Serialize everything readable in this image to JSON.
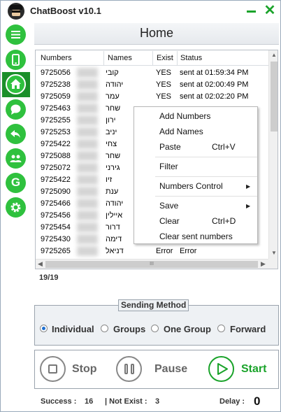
{
  "app": {
    "title": "ChatBoost v10.1"
  },
  "header": {
    "title": "Home"
  },
  "sidebar": {
    "items": [
      {
        "name": "menu"
      },
      {
        "name": "phone"
      },
      {
        "name": "home"
      },
      {
        "name": "chat"
      },
      {
        "name": "back"
      },
      {
        "name": "contacts"
      },
      {
        "name": "groups-g"
      },
      {
        "name": "settings"
      }
    ],
    "g_label": "G"
  },
  "grid": {
    "columns": [
      "Numbers",
      "Names",
      "Exist",
      "Status"
    ],
    "rows": [
      {
        "number": "9725056",
        "name": "קובי",
        "exist": "YES",
        "status": "sent at 01:59:34 PM"
      },
      {
        "number": "9725238",
        "name": "יהודה",
        "exist": "YES",
        "status": "sent at 02:00:49 PM"
      },
      {
        "number": "9725059",
        "name": "עמר",
        "exist": "YES",
        "status": "sent at 02:02:20 PM"
      },
      {
        "number": "9725463",
        "name": "שחר",
        "exist": "",
        "status": ""
      },
      {
        "number": "9725255",
        "name": "ירון",
        "exist": "",
        "status": ""
      },
      {
        "number": "9725253",
        "name": "יניב",
        "exist": "",
        "status": ""
      },
      {
        "number": "9725422",
        "name": "צחי",
        "exist": "",
        "status": ""
      },
      {
        "number": "9725088",
        "name": "שחר",
        "exist": "",
        "status": ""
      },
      {
        "number": "9725072",
        "name": "גירני",
        "exist": "",
        "status": ""
      },
      {
        "number": "9725422",
        "name": "זיו",
        "exist": "",
        "status": ""
      },
      {
        "number": "9725090",
        "name": "ענת",
        "exist": "",
        "status": ""
      },
      {
        "number": "9725466",
        "name": "יהודה",
        "exist": "",
        "status": ""
      },
      {
        "number": "9725456",
        "name": "איילין",
        "exist": "",
        "status": ""
      },
      {
        "number": "9725454",
        "name": "דרור",
        "exist": "",
        "status": ""
      },
      {
        "number": "9725430",
        "name": "דימה",
        "exist": "",
        "status": ""
      },
      {
        "number": "9725265",
        "name": "דניאל",
        "exist": "Error",
        "status": "Error"
      }
    ],
    "hscroll_grip": "III"
  },
  "context_menu": {
    "add_numbers": "Add Numbers",
    "add_names": "Add Names",
    "paste": "Paste",
    "paste_key": "Ctrl+V",
    "filter": "Filter",
    "numbers_control": "Numbers Control",
    "save": "Save",
    "clear": "Clear",
    "clear_key": "Ctrl+D",
    "clear_sent": "Clear sent numbers"
  },
  "count": "19/19",
  "sending_method": {
    "legend": "Sending Method",
    "options": [
      "Individual",
      "Groups",
      "One Group",
      "Forward"
    ],
    "selected": "Individual"
  },
  "controls": {
    "stop": "Stop",
    "pause": "Pause",
    "start": "Start"
  },
  "footer": {
    "success_label": "Success :",
    "success_value": "16",
    "not_exist_label": "| Not Exist :",
    "not_exist_value": "3",
    "delay_label": "Delay :",
    "delay_value": "0"
  },
  "colors": {
    "accent_green": "#2fc13e",
    "active_green": "#1b8f2a",
    "radio_blue": "#1e6fd0"
  }
}
